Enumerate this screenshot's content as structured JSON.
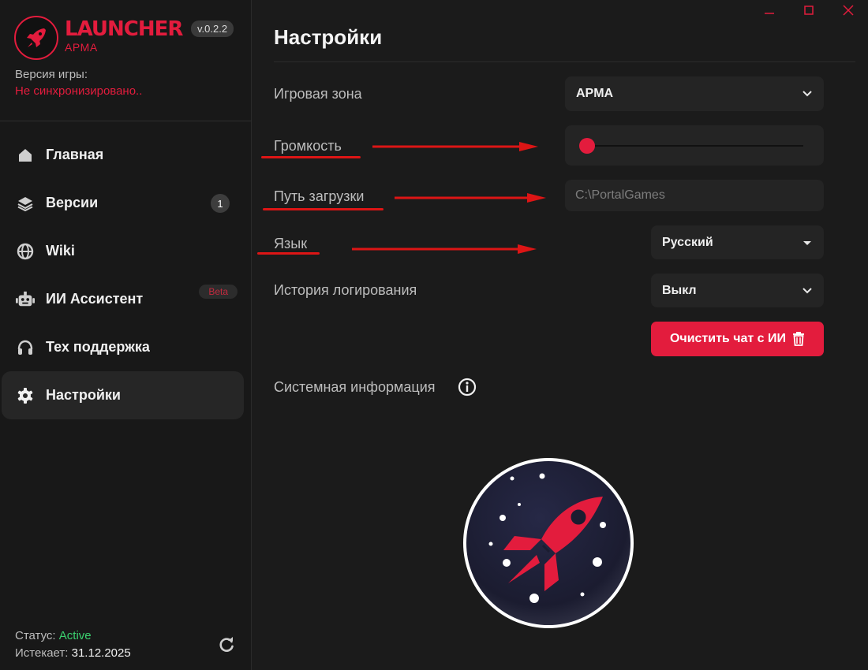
{
  "brand": {
    "name": "LAUNCHER",
    "sub": "APMA",
    "version": "v.0.2.2"
  },
  "game_version": {
    "label": "Версия игры:",
    "value": "Не синхронизировано.."
  },
  "nav": {
    "items": [
      {
        "label": "Главная",
        "icon": "home-icon"
      },
      {
        "label": "Версии",
        "icon": "layers-icon",
        "badge": "1"
      },
      {
        "label": "Wiki",
        "icon": "globe-icon"
      },
      {
        "label": "ИИ Ассистент",
        "icon": "robot-icon",
        "tag": "Beta"
      },
      {
        "label": "Тех поддержка",
        "icon": "headphones-icon"
      },
      {
        "label": "Настройки",
        "icon": "gear-icon",
        "active": true
      }
    ]
  },
  "footer": {
    "status_label": "Статус:",
    "status_value": "Active",
    "expires_label": "Истекает:",
    "expires_value": "31.12.2025",
    "refresh_icon": "refresh-icon"
  },
  "window_controls": [
    "minimize-icon",
    "maximize-icon",
    "close-icon"
  ],
  "main": {
    "title": "Настройки",
    "game_zone": {
      "label": "Игровая зона",
      "value": "APMA"
    },
    "volume": {
      "label": "Громкость",
      "value": 0
    },
    "download_path": {
      "label": "Путь загрузки",
      "placeholder": "C:\\PortalGames"
    },
    "language": {
      "label": "Язык",
      "value": "Русский"
    },
    "log_history": {
      "label": "История логирования",
      "value": "Выкл"
    },
    "clear_chat_label": "Очистить чат с ИИ",
    "system_info_label": "Системная информация"
  },
  "colors": {
    "accent": "#e31c3d",
    "active_status": "#3bd16f",
    "annotation": "#dd1515"
  }
}
